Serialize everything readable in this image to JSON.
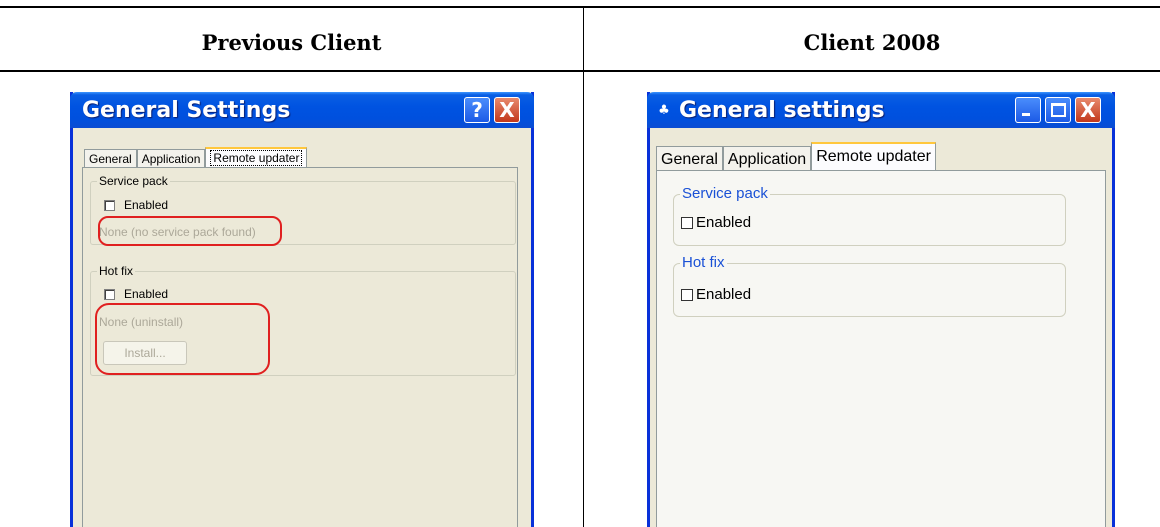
{
  "columns": {
    "left_header": "Previous Client",
    "right_header": "Client 2008"
  },
  "previous_client": {
    "window_title": "General Settings",
    "titlebar_buttons": {
      "help": "?",
      "close": "X"
    },
    "tabs": [
      {
        "label": "General",
        "active": false
      },
      {
        "label": "Application",
        "active": false
      },
      {
        "label": "Remote updater",
        "active": true
      }
    ],
    "service_pack": {
      "group_label": "Service pack",
      "checkbox_label": "Enabled",
      "checked": false,
      "status_text": "None (no service pack found)"
    },
    "hot_fix": {
      "group_label": "Hot fix",
      "checkbox_label": "Enabled",
      "checked": false,
      "status_text": "None (uninstall)",
      "install_button_label": "Install..."
    },
    "highlight_color": "#e02020"
  },
  "client_2008": {
    "window_title": "General settings",
    "titlebar_buttons": {
      "close": "X"
    },
    "tabs": [
      {
        "label": "General",
        "active": false
      },
      {
        "label": "Application",
        "active": false
      },
      {
        "label": "Remote updater",
        "active": true
      }
    ],
    "service_pack": {
      "group_label": "Service pack",
      "checkbox_label": "Enabled",
      "checked": false
    },
    "hot_fix": {
      "group_label": "Hot fix",
      "checkbox_label": "Enabled",
      "checked": false
    },
    "group_label_color": "#1a51d6"
  },
  "colors": {
    "xp_titlebar_blue": "#0053e1",
    "xp_window_face": "#ece9d8",
    "xp_close_red": "#c2381c"
  }
}
